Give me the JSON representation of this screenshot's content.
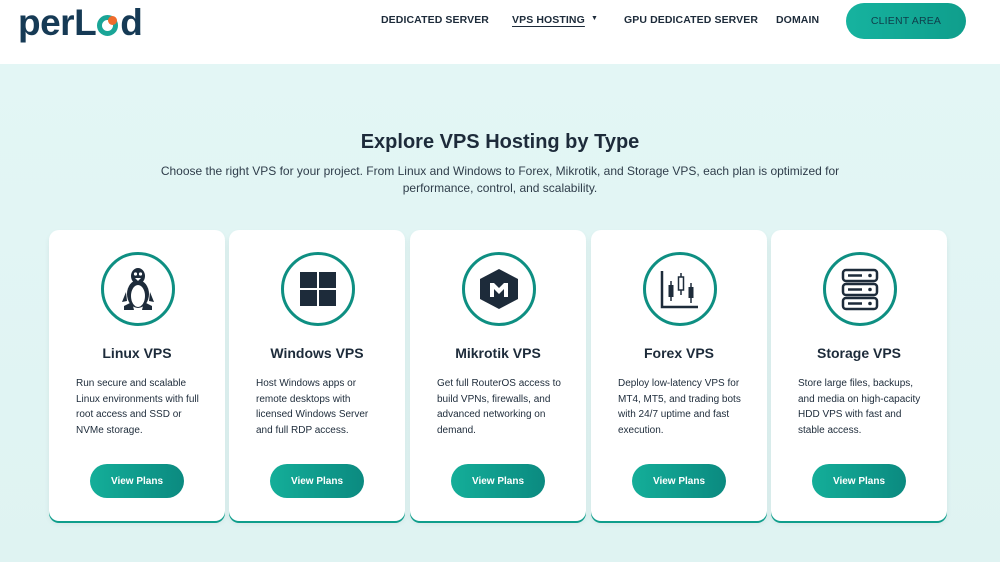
{
  "brand": {
    "logo_prefix": "per",
    "logo_mid": "L",
    "logo_suffix": "d",
    "accent": "#1aa597",
    "dot_color": "#ef6b2c"
  },
  "nav": {
    "items": [
      {
        "label": "DEDICATED SERVER"
      },
      {
        "label": "VPS HOSTING"
      },
      {
        "label": "GPU DEDICATED SERVER"
      },
      {
        "label": "DOMAIN"
      }
    ],
    "client_area": "CLIENT AREA"
  },
  "hero": {
    "title": "Explore VPS Hosting by Type",
    "subtitle": "Choose the right VPS for your project. From Linux and Windows to Forex, Mikrotik, and Storage VPS, each plan is optimized for performance, control, and scalability."
  },
  "cards": [
    {
      "icon": "linux-penguin-icon",
      "title": "Linux VPS",
      "desc": "Run secure and scalable Linux environments with full root access and SSD or NVMe storage.",
      "button": "View Plans"
    },
    {
      "icon": "windows-logo-icon",
      "title": "Windows VPS",
      "desc": "Host Windows apps or remote desktops with licensed Windows Server and full RDP access.",
      "button": "View Plans"
    },
    {
      "icon": "mikrotik-logo-icon",
      "title": "Mikrotik VPS",
      "desc": "Get full RouterOS access to build VPNs, firewalls, and advanced networking on demand.",
      "button": "View Plans"
    },
    {
      "icon": "candlestick-chart-icon",
      "title": "Forex VPS",
      "desc": "Deploy low-latency VPS for MT4, MT5, and trading bots with 24/7 uptime and fast execution.",
      "button": "View Plans"
    },
    {
      "icon": "server-storage-icon",
      "title": "Storage VPS",
      "desc": "Store large files, backups, and media on high-capacity HDD VPS with fast and stable access.",
      "button": "View Plans"
    }
  ]
}
